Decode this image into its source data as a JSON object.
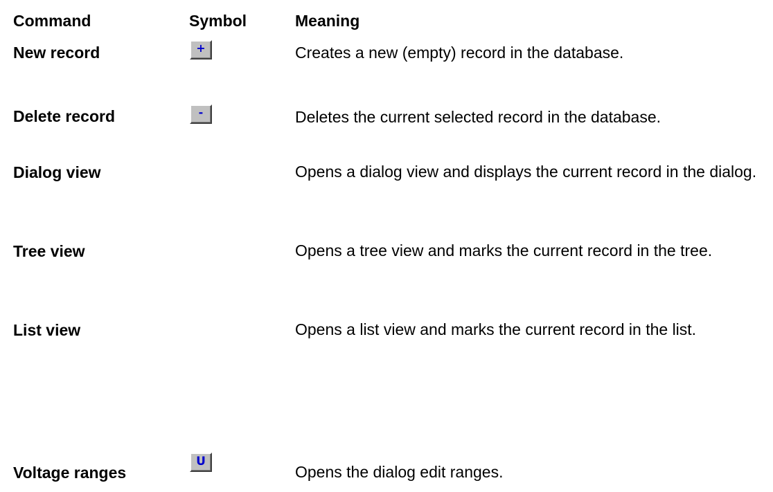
{
  "header": {
    "command": "Command",
    "symbol": "Symbol",
    "meaning": "Meaning"
  },
  "rows": [
    {
      "command": "New record",
      "symbol": "+",
      "symbol_icon": "plus-button-icon",
      "meaning": "Creates a new (empty) record in the database."
    },
    {
      "command": "Delete record",
      "symbol": "-",
      "symbol_icon": "minus-button-icon",
      "meaning": "Deletes the current selected record in the database."
    },
    {
      "command": "Dialog view",
      "meaning": "Opens a dialog view and displays the current record in the dialog."
    },
    {
      "command": "Tree view",
      "meaning": "Opens a tree view and marks the current record in the tree."
    },
    {
      "command": "List view",
      "meaning": "Opens a list view and marks the current record in the list."
    },
    {
      "command": "Voltage ranges",
      "symbol": "U",
      "symbol_icon": "voltage-u-button-icon",
      "meaning": "Opens the dialog edit ranges."
    }
  ],
  "colors": {
    "button_face": "#c0c0c0",
    "button_glyph": "#0000cc",
    "text": "#000000",
    "background": "#ffffff"
  }
}
